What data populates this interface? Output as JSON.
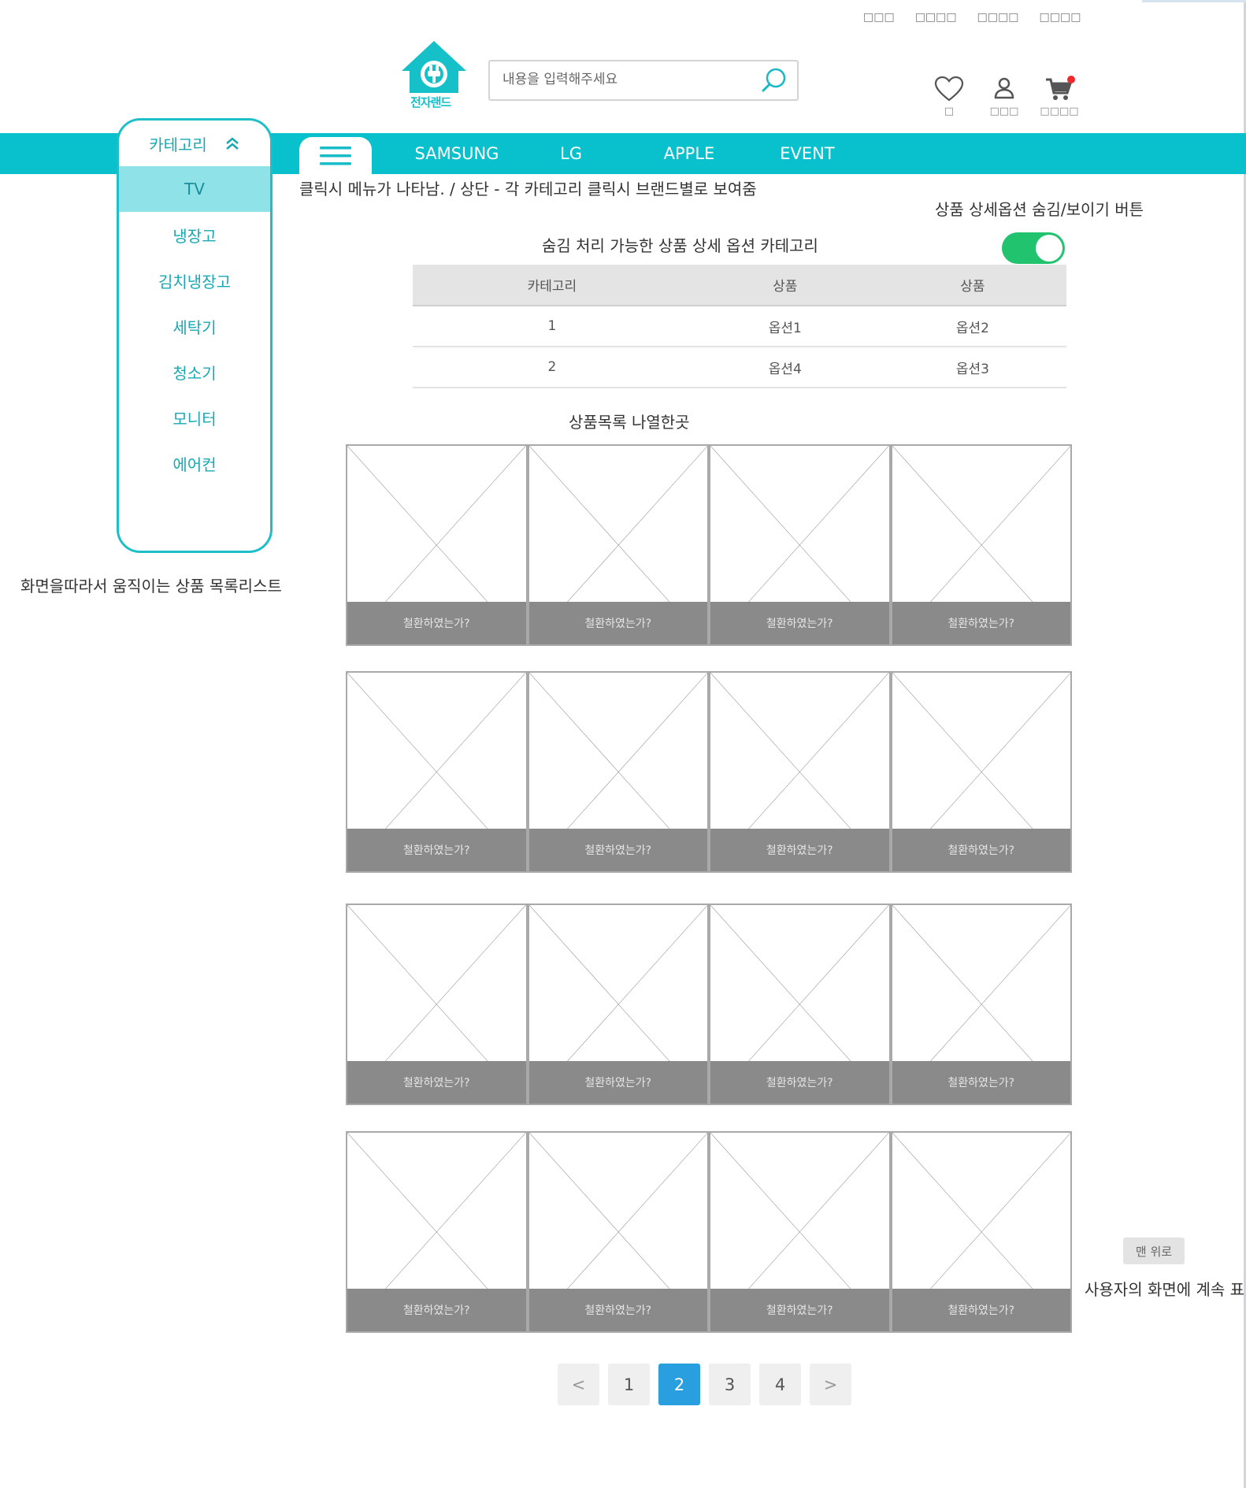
{
  "header": {
    "top_links": [
      "□□□",
      "□□□□",
      "□□□□",
      "□□□□"
    ],
    "logo_text": "전자랜드",
    "search_placeholder": "내용을 입력해주세요",
    "icons": [
      {
        "icon": "heart-icon",
        "label": "□"
      },
      {
        "icon": "user-icon",
        "label": "□□□"
      },
      {
        "icon": "cart-icon",
        "label": "□□□□"
      }
    ]
  },
  "nav": {
    "items": [
      "SAMSUNG",
      "LG",
      "APPLE",
      "EVENT"
    ]
  },
  "category": {
    "title": "카테고리",
    "items": [
      "TV",
      "냉장고",
      "김치냉장고",
      "세탁기",
      "청소기",
      "모니터",
      "에어컨"
    ],
    "active": "TV"
  },
  "notes": {
    "menu_note": "클릭시 메뉴가 나타남. / 상단 - 각 카테고리 클릭시 브랜드별로 보여줌",
    "toggle_note": "상품 상세옵션 숨김/보이기 버튼",
    "options_note": "숨김 처리 가능한 상품 상세 옵션 카테고리",
    "list_note": "상품목록 나열한곳",
    "sidebar_note": "화면을따라서 움직이는 상품 목록리스트",
    "topbtn_note": "사용자의 화면에 계속 표"
  },
  "options_table": {
    "headers": [
      "카테고리",
      "상품",
      "상품"
    ],
    "rows": [
      [
        "1",
        "옵션1",
        "옵션2"
      ],
      [
        "2",
        "옵션4",
        "옵션3"
      ]
    ]
  },
  "products": {
    "caption": "철환하였는가?",
    "rows": 4,
    "cols": 4
  },
  "pagination": {
    "prev": "<",
    "pages": [
      "1",
      "2",
      "3",
      "4"
    ],
    "current": "2",
    "next": ">"
  },
  "top_button": "맨 위로",
  "colors": {
    "brand": "#08c1cc",
    "toggle_on": "#21c36e",
    "page_active": "#2a9fe0"
  }
}
